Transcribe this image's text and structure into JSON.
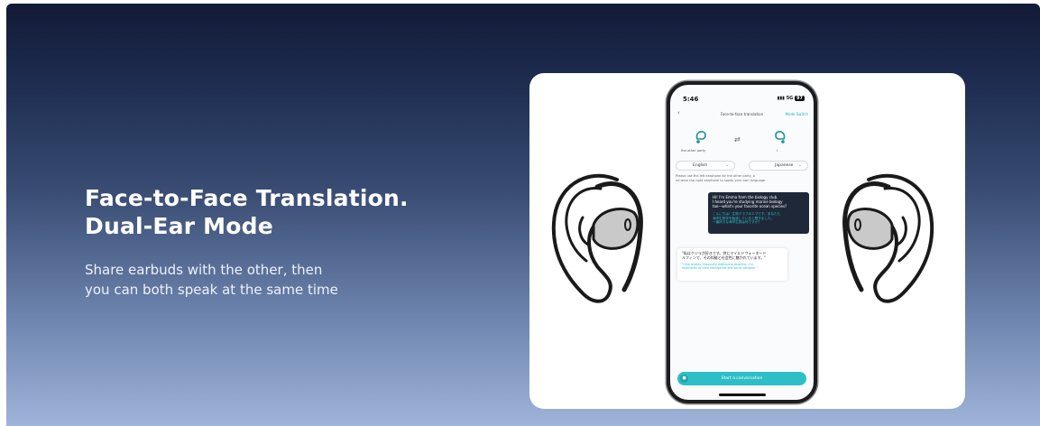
{
  "hero": {
    "title_line1": "Face-to-Face Translation.",
    "title_line2": "Dual-Ear Mode",
    "sub_line1": "Share earbuds with the other, then",
    "sub_line2": "you can both speak at the same time"
  },
  "phone": {
    "time": "5:46",
    "network": "5G",
    "battery": "97",
    "nav_title": "Face-to-face translation",
    "nav_action": "Mode Switch",
    "device_left_label": "the other party",
    "device_right_label": "I",
    "lang_left": "English",
    "lang_right": "Japanese",
    "hint_line1": "Please use the left earphone for the other party, a",
    "hint_line2": "nd wear the right earphone to speak your own language.",
    "msg_right_en_1": "Hi! I'm Emma from the biology club.",
    "msg_right_en_2": "I heard you're studying marine biology",
    "msg_right_en_3": "too—what's your favorite ocean species?",
    "msg_right_jp_1": "こんにちは！生物クラブのエマです。あなたも",
    "msg_right_jp_2": "海洋生物学を勉強していると聞きました。",
    "msg_right_jp_3": "一番好きな海洋生物は何ですか？",
    "msg_left_jp_1": "\"私はクジラが好きです。特にマイルドウォータード",
    "msg_left_jp_2": "ルフィンで、その知能と社会性に魅かれています。\"",
    "msg_left_en_1": "\"I like whales. Especially bottlenose dolphins—I'm",
    "msg_left_en_2": "fascinated by their intelligence and social behavior.\"",
    "cta_label": "Start a conversation"
  },
  "colors": {
    "accent": "#2dbfc7",
    "banner_top": "#121a36",
    "banner_bottom": "#9fb4d8",
    "bubble_dark": "#1f2838"
  }
}
